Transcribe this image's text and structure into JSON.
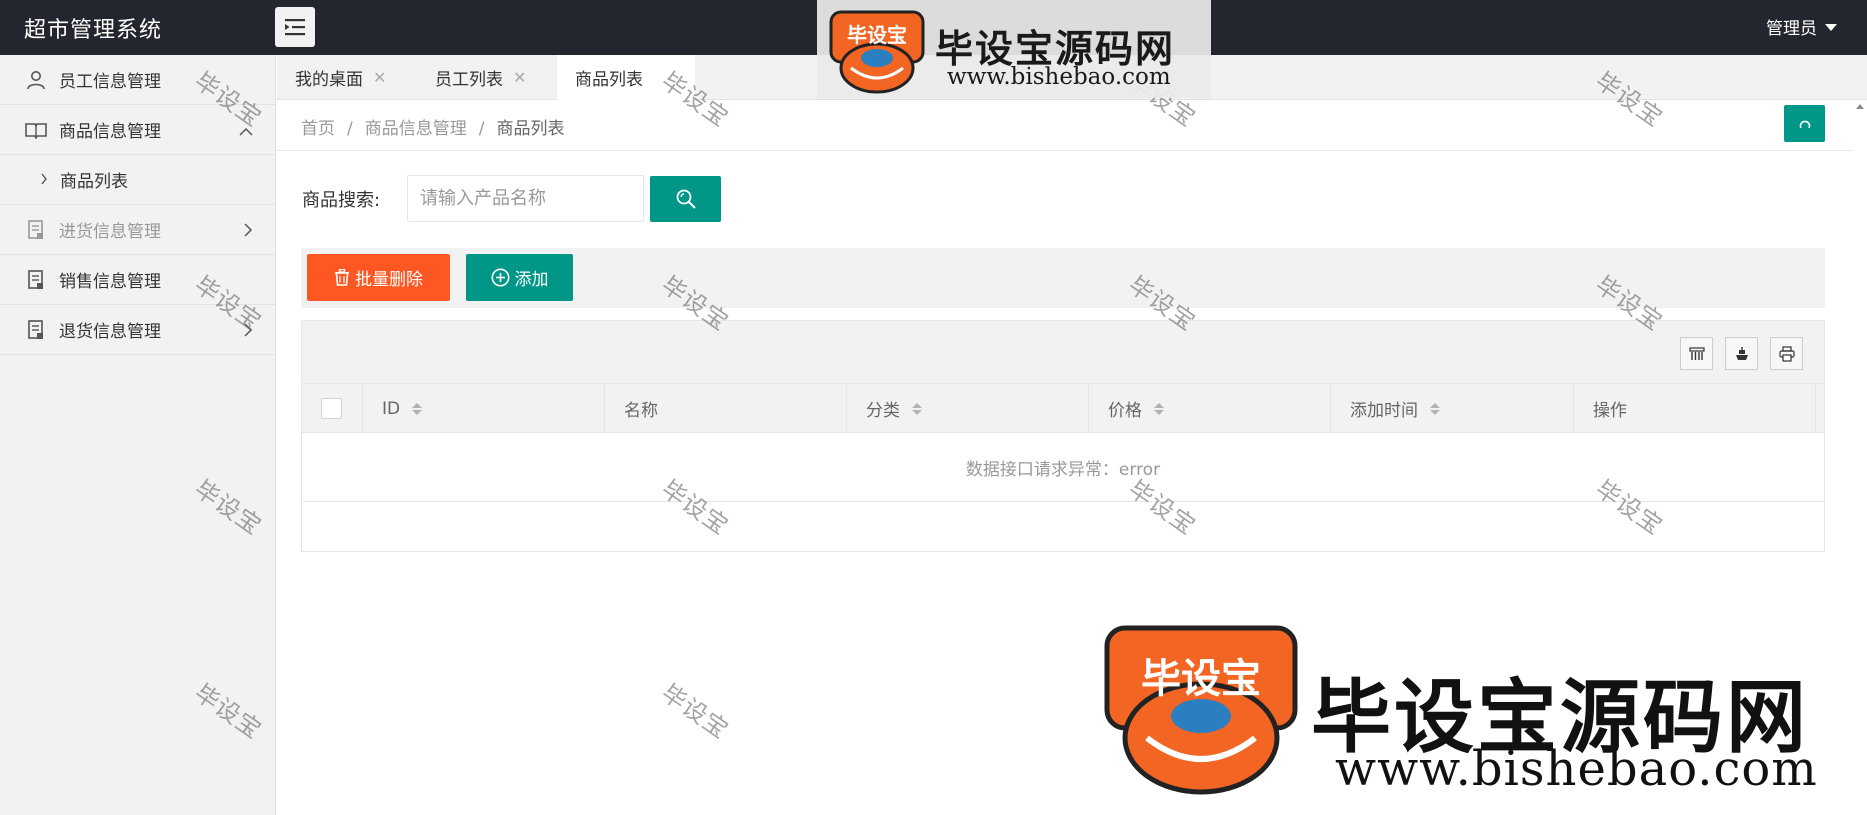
{
  "header": {
    "app_title": "超市管理系统",
    "user_label": "管理员"
  },
  "sidebar": {
    "items": [
      {
        "label": "员工信息管理",
        "icon": "user-icon",
        "disabled": false
      },
      {
        "label": "商品信息管理",
        "icon": "book-icon",
        "expanded": true,
        "children": [
          {
            "label": "商品列表"
          }
        ]
      },
      {
        "label": "进货信息管理",
        "icon": "receipt-icon",
        "disabled": true
      },
      {
        "label": "销售信息管理",
        "icon": "receipt-icon",
        "disabled": false
      },
      {
        "label": "退货信息管理",
        "icon": "receipt-icon",
        "disabled": false
      }
    ]
  },
  "tabs": [
    {
      "label": "我的桌面",
      "closable": true,
      "active": false
    },
    {
      "label": "员工列表",
      "closable": true,
      "active": false
    },
    {
      "label": "商品列表",
      "closable": false,
      "active": true
    }
  ],
  "breadcrumb": [
    "首页",
    "商品信息管理",
    "商品列表"
  ],
  "search": {
    "label": "商品搜索:",
    "placeholder": "请输入产品名称"
  },
  "actions": {
    "batch_delete": "批量删除",
    "add": "添加"
  },
  "table": {
    "columns": [
      {
        "label": "ID",
        "sortable": true
      },
      {
        "label": "名称",
        "sortable": false
      },
      {
        "label": "分类",
        "sortable": true
      },
      {
        "label": "价格",
        "sortable": true
      },
      {
        "label": "添加时间",
        "sortable": true
      },
      {
        "label": "操作",
        "sortable": false
      }
    ],
    "empty_message": "数据接口请求异常：error"
  },
  "watermark": {
    "text": "毕设宝",
    "brand": "毕设宝源码网",
    "url": "www.bishebao.com",
    "logo_text": "毕设宝"
  },
  "colors": {
    "header_bg": "#23262e",
    "primary": "#009688",
    "danger": "#ff5722",
    "sidebar_bg": "#f2f2f2",
    "logo_orange": "#f26522"
  }
}
